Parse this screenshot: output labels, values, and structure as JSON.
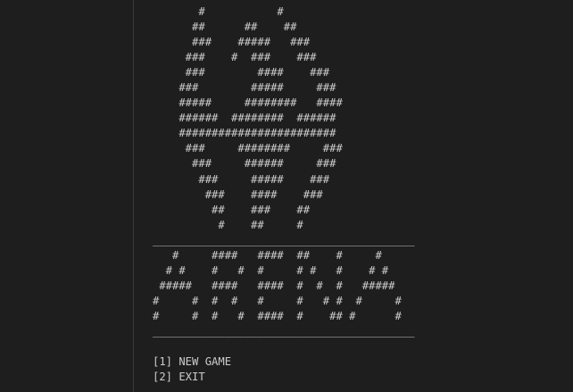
{
  "terminal": {
    "art_lines": [
      "       #           #",
      "      ##      ##    ##",
      "      ###    #####   ###",
      "     ###    #  ###    ###",
      "     ###        ####    ###",
      "    ###        #####     ###",
      "    #####     ########   ####",
      "    ######  ########  ######",
      "    ########################",
      "     ###     ########     ###",
      "      ###     ######     ###",
      "       ###     #####    ###",
      "        ###    ####    ###",
      "         ##    ###    ##",
      "          #    ##     #"
    ],
    "divider_top": "________________________________________",
    "title_lines": [
      "   #     ####   ####  ##    #     #",
      "  # #    #   #  #     # #   #    # #",
      " #####   ####   ####  #  #  #   #####",
      "#     #  #  #   #     #   # #  #     #",
      "#     #  #   #  ####  #    ## #      #"
    ],
    "divider_bottom": "________________________________________",
    "menu": [
      {
        "label": "[1] NEW GAME"
      },
      {
        "label": "[2] EXIT"
      }
    ]
  }
}
